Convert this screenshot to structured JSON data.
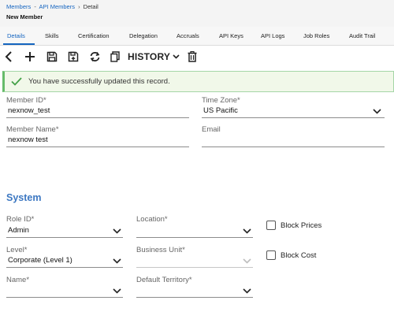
{
  "breadcrumb": {
    "members": "Members",
    "api_members": "API Members",
    "current": "Detail",
    "separator": "-",
    "arrow": "›"
  },
  "page_title": "New Member",
  "tabs": [
    {
      "label": "Details",
      "active": true
    },
    {
      "label": "Skills"
    },
    {
      "label": "Certification"
    },
    {
      "label": "Delegation"
    },
    {
      "label": "Accruals"
    },
    {
      "label": "API Keys"
    },
    {
      "label": "API Logs"
    },
    {
      "label": "Job Roles"
    },
    {
      "label": "Audit Trail"
    }
  ],
  "toolbar": {
    "icons": [
      "back-icon",
      "add-icon",
      "save-icon",
      "save-as-icon",
      "refresh-icon",
      "copy-icon",
      "history-chevron-icon",
      "delete-icon"
    ],
    "history_label": "HISTORY"
  },
  "alert": {
    "message": "You have successfully updated this record.",
    "icon": "checkmark-icon"
  },
  "form": {
    "member_id": {
      "label": "Member ID*",
      "value": "nexnow_test"
    },
    "time_zone": {
      "label": "Time Zone*",
      "value": "US Pacific"
    },
    "member_name": {
      "label": "Member Name*",
      "value": "nexnow test"
    },
    "email": {
      "label": "Email",
      "value": ""
    }
  },
  "system": {
    "title": "System",
    "role_id": {
      "label": "Role ID*",
      "value": "Admin"
    },
    "location": {
      "label": "Location*",
      "value": ""
    },
    "level": {
      "label": "Level*",
      "value": "Corporate (Level 1)"
    },
    "business_unit": {
      "label": "Business Unit*",
      "value": ""
    },
    "name": {
      "label": "Name*",
      "value": ""
    },
    "default_territory": {
      "label": "Default Territory*",
      "value": ""
    },
    "block_prices": {
      "label": "Block Prices",
      "checked": false
    },
    "block_cost": {
      "label": "Block Cost",
      "checked": false
    }
  },
  "colors": {
    "accent": "#1565c0",
    "section_title": "#3d78c2",
    "success_border": "#66bb6a",
    "success_bg": "#f1f8e9"
  }
}
